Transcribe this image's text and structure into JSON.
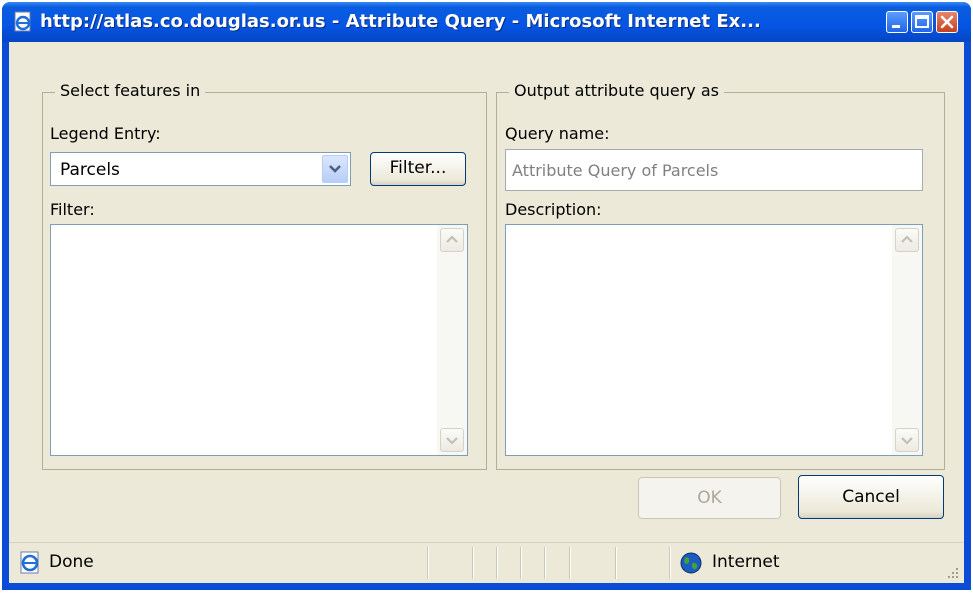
{
  "window": {
    "title": "http://atlas.co.douglas.or.us - Attribute Query - Microsoft Internet Ex...",
    "icon": "ie-page-icon"
  },
  "select_group": {
    "legend": "Select features in",
    "legend_entry_label": "Legend Entry:",
    "legend_entry_value": "Parcels",
    "filter_button": "Filter...",
    "filter_label": "Filter:",
    "filter_value": ""
  },
  "output_group": {
    "legend": "Output attribute query as",
    "query_name_label": "Query name:",
    "query_name_value": "Attribute Query of Parcels",
    "description_label": "Description:",
    "description_value": ""
  },
  "buttons": {
    "ok": "OK",
    "cancel": "Cancel"
  },
  "status": {
    "text": "Done",
    "zone": "Internet"
  },
  "colors": {
    "titlebar": "#0554e3",
    "dialog_bg": "#ece9d8",
    "disabled_text": "#aca899"
  }
}
